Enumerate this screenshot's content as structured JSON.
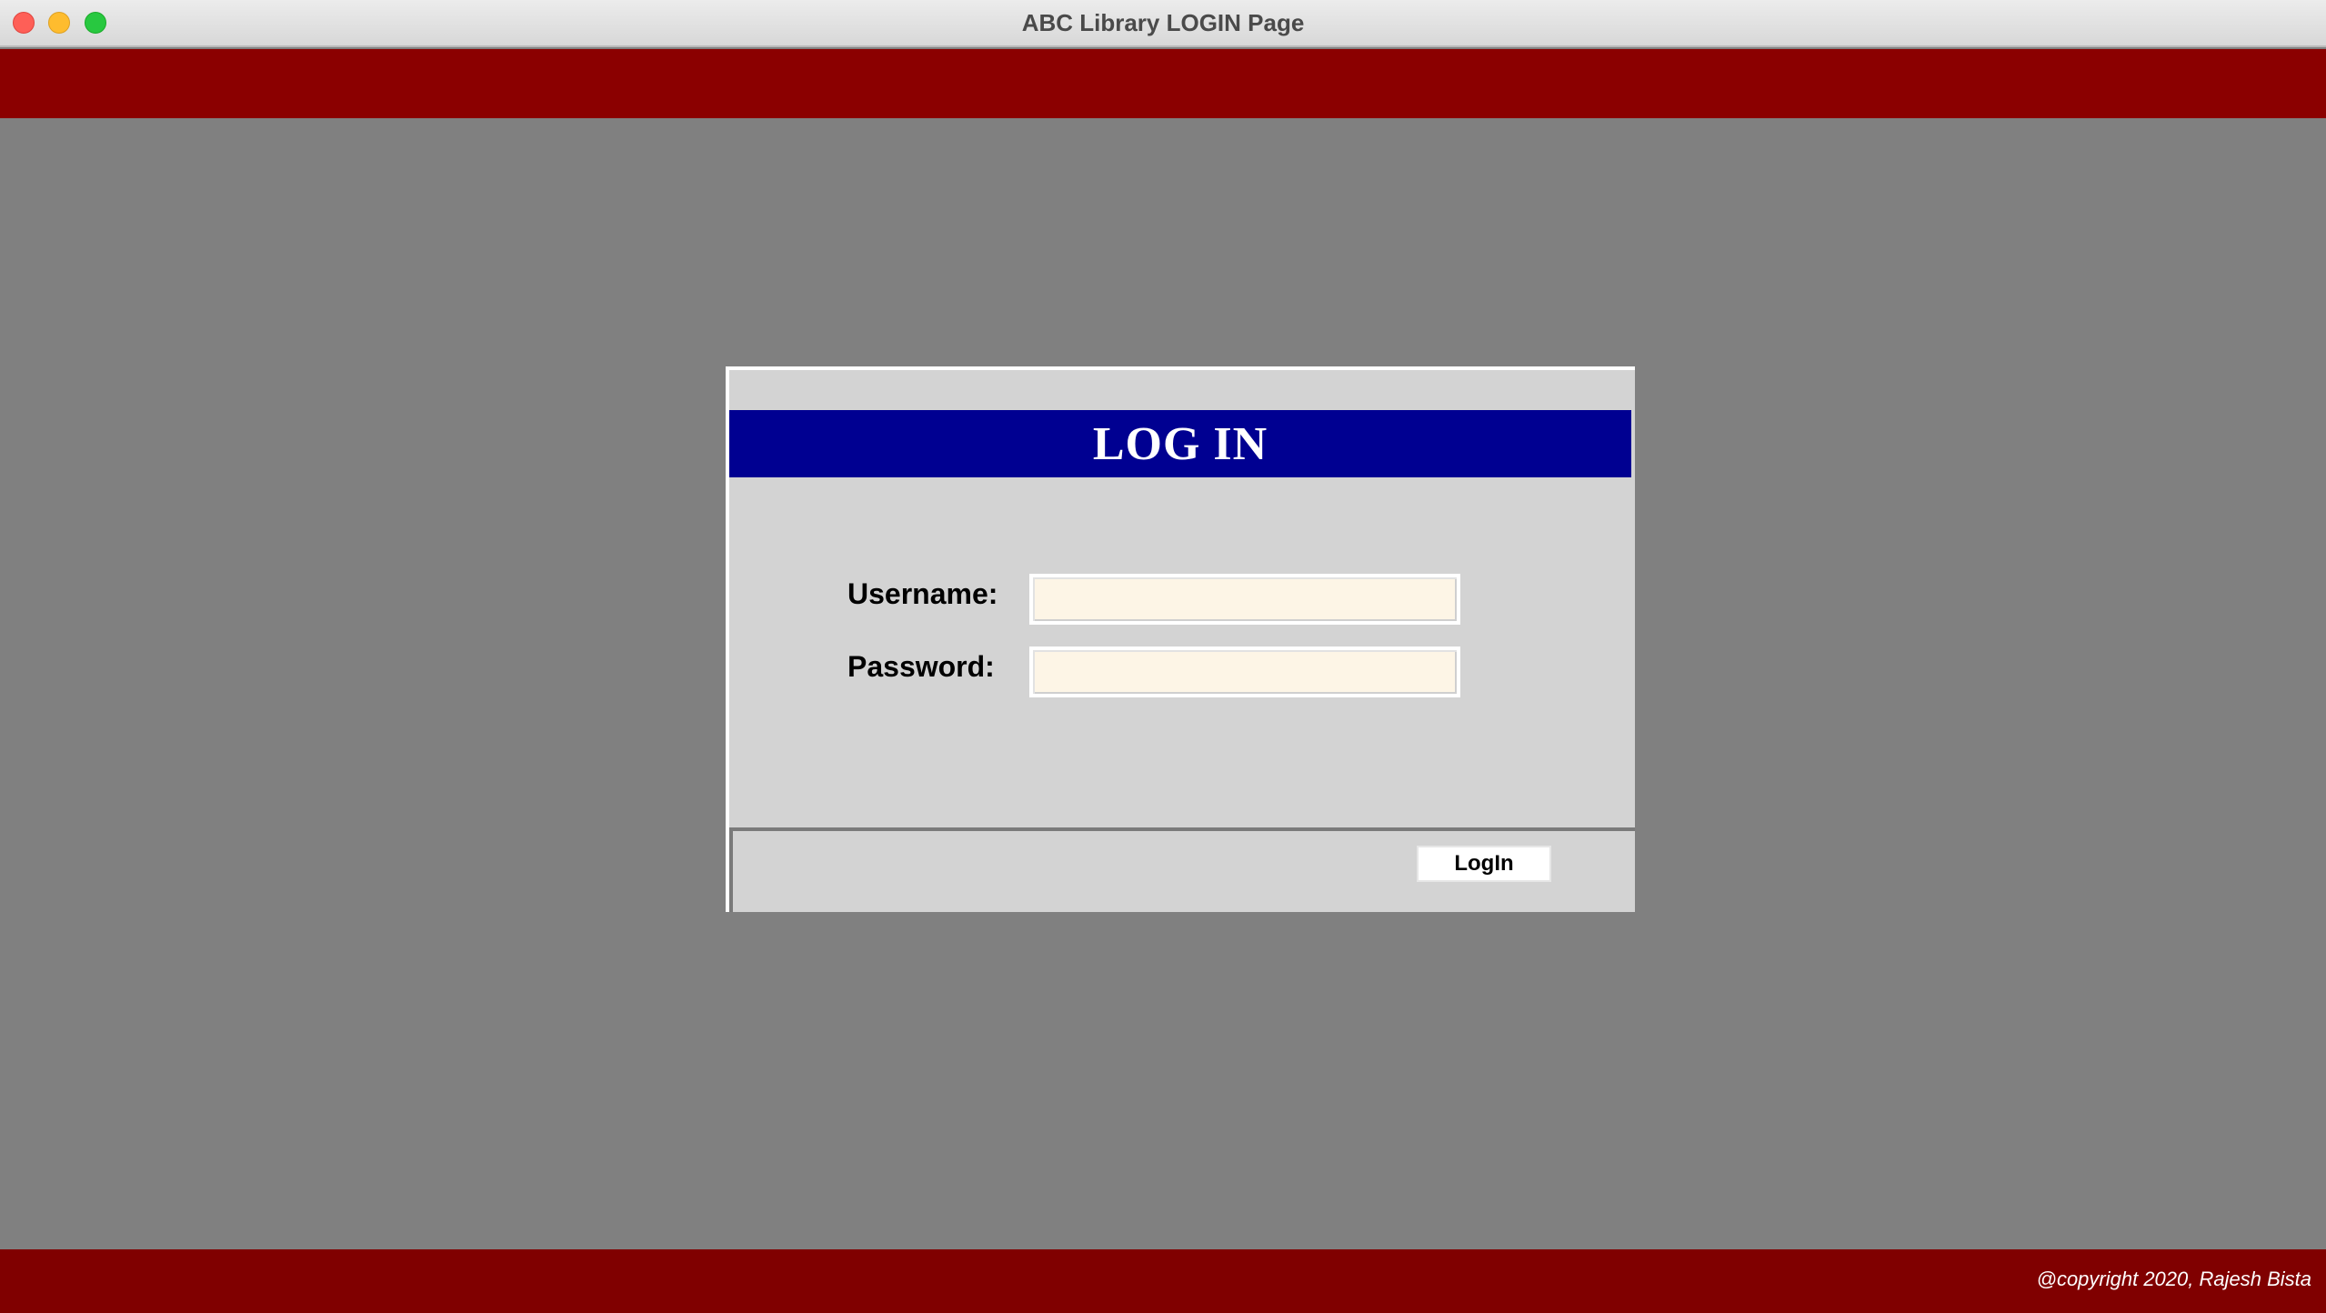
{
  "window": {
    "title": "ABC Library LOGIN Page"
  },
  "colors": {
    "header_strip": "#8b0000",
    "footer_strip": "#800000",
    "background": "#808080",
    "panel": "#d3d3d3",
    "banner": "#000091",
    "input_bg": "#fdf5e6"
  },
  "login": {
    "title": "LOG IN",
    "username_label": "Username:",
    "username_value": "",
    "password_label": "Password:",
    "password_value": "",
    "button_label": "LogIn"
  },
  "footer": {
    "copyright": "@copyright 2020, Rajesh Bista"
  }
}
